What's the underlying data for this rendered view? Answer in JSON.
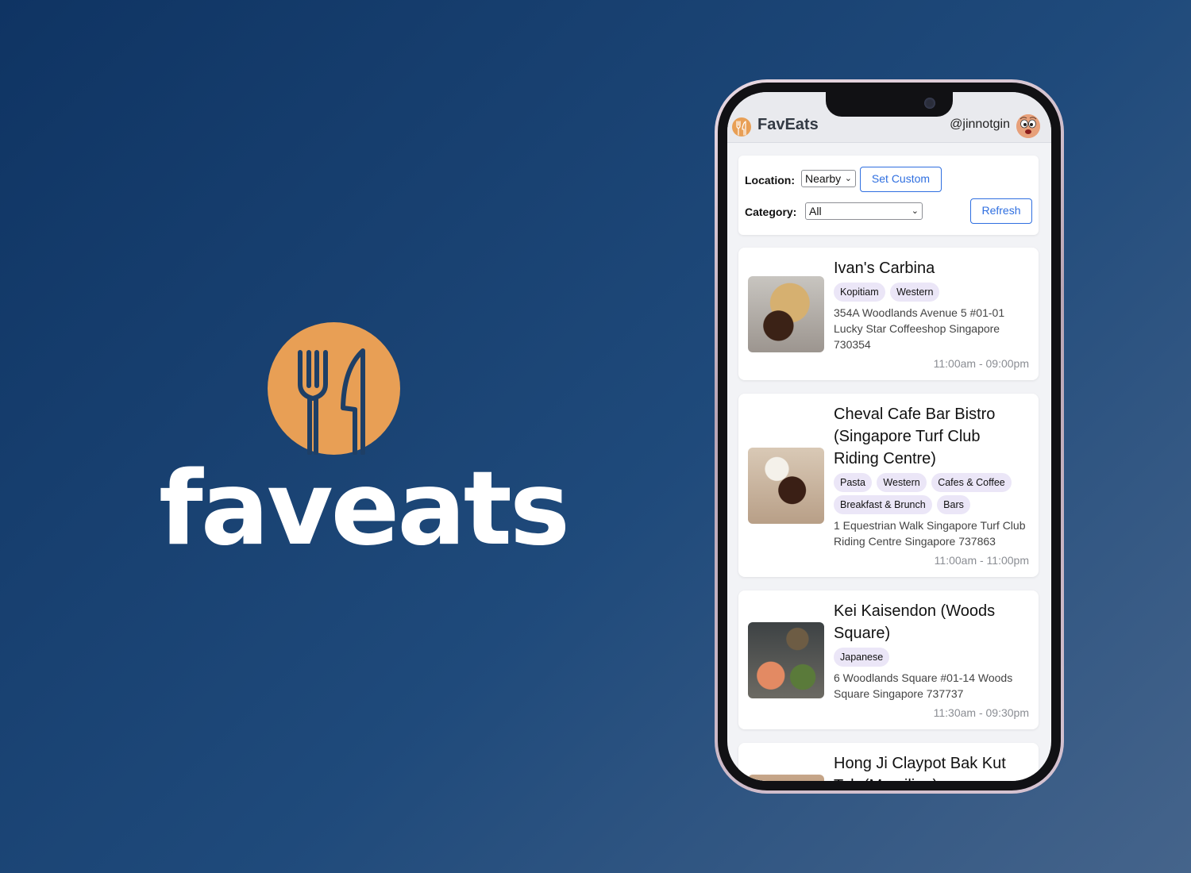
{
  "brand": {
    "wordmark": "faveats",
    "logo_icon": "fork-knife-icon",
    "accent_color": "#E89F55",
    "icon_color": "#1E3F66"
  },
  "app": {
    "title": "FavEats",
    "username": "@jinnotgin",
    "avatar_icon": "avatar-face-icon"
  },
  "filters": {
    "location_label": "Location:",
    "location_value": "Nearby",
    "set_custom_label": "Set Custom",
    "category_label": "Category:",
    "category_value": "All",
    "refresh_label": "Refresh"
  },
  "restaurants": [
    {
      "name": "Ivan's Carbina",
      "tags": [
        "Kopitiam",
        "Western"
      ],
      "address": "354A Woodlands Avenue 5 #01-01 Lucky Star Coffeeshop Singapore 730354",
      "hours": "11:00am - 09:00pm"
    },
    {
      "name": "Cheval Cafe Bar Bistro (Singapore Turf Club Riding Centre)",
      "tags": [
        "Pasta",
        "Western",
        "Cafes & Coffee",
        "Breakfast & Brunch",
        "Bars"
      ],
      "address": "1 Equestrian Walk Singapore Turf Club Riding Centre Singapore 737863",
      "hours": "11:00am - 11:00pm"
    },
    {
      "name": "Kei Kaisendon (Woods Square)",
      "tags": [
        "Japanese"
      ],
      "address": "6 Woodlands Square #01-14 Woods Square Singapore 737737",
      "hours": "11:30am - 09:30pm"
    },
    {
      "name": "Hong Ji Claypot Bak Kut Teh (Marsiling)"
    }
  ]
}
